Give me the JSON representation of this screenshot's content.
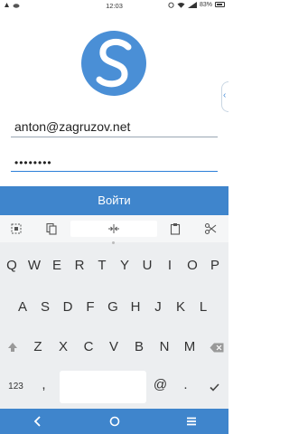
{
  "status_bar": {
    "time": "12:03",
    "battery": "83%"
  },
  "login_form": {
    "email_value": "anton@zagruzov.net",
    "password_value": "••••••••",
    "login_button_label": "Войти"
  },
  "keyboard": {
    "row1": [
      "Q",
      "W",
      "E",
      "R",
      "T",
      "Y",
      "U",
      "I",
      "O",
      "P"
    ],
    "row2": [
      "A",
      "S",
      "D",
      "F",
      "G",
      "H",
      "J",
      "K",
      "L"
    ],
    "row3": [
      "Z",
      "X",
      "C",
      "V",
      "B",
      "N",
      "M"
    ],
    "numbers_key": "123",
    "comma_key": ",",
    "at_key": "@",
    "period_key": "."
  },
  "colors": {
    "accent": "#3f85cc",
    "logo": "#4a8fd6"
  }
}
